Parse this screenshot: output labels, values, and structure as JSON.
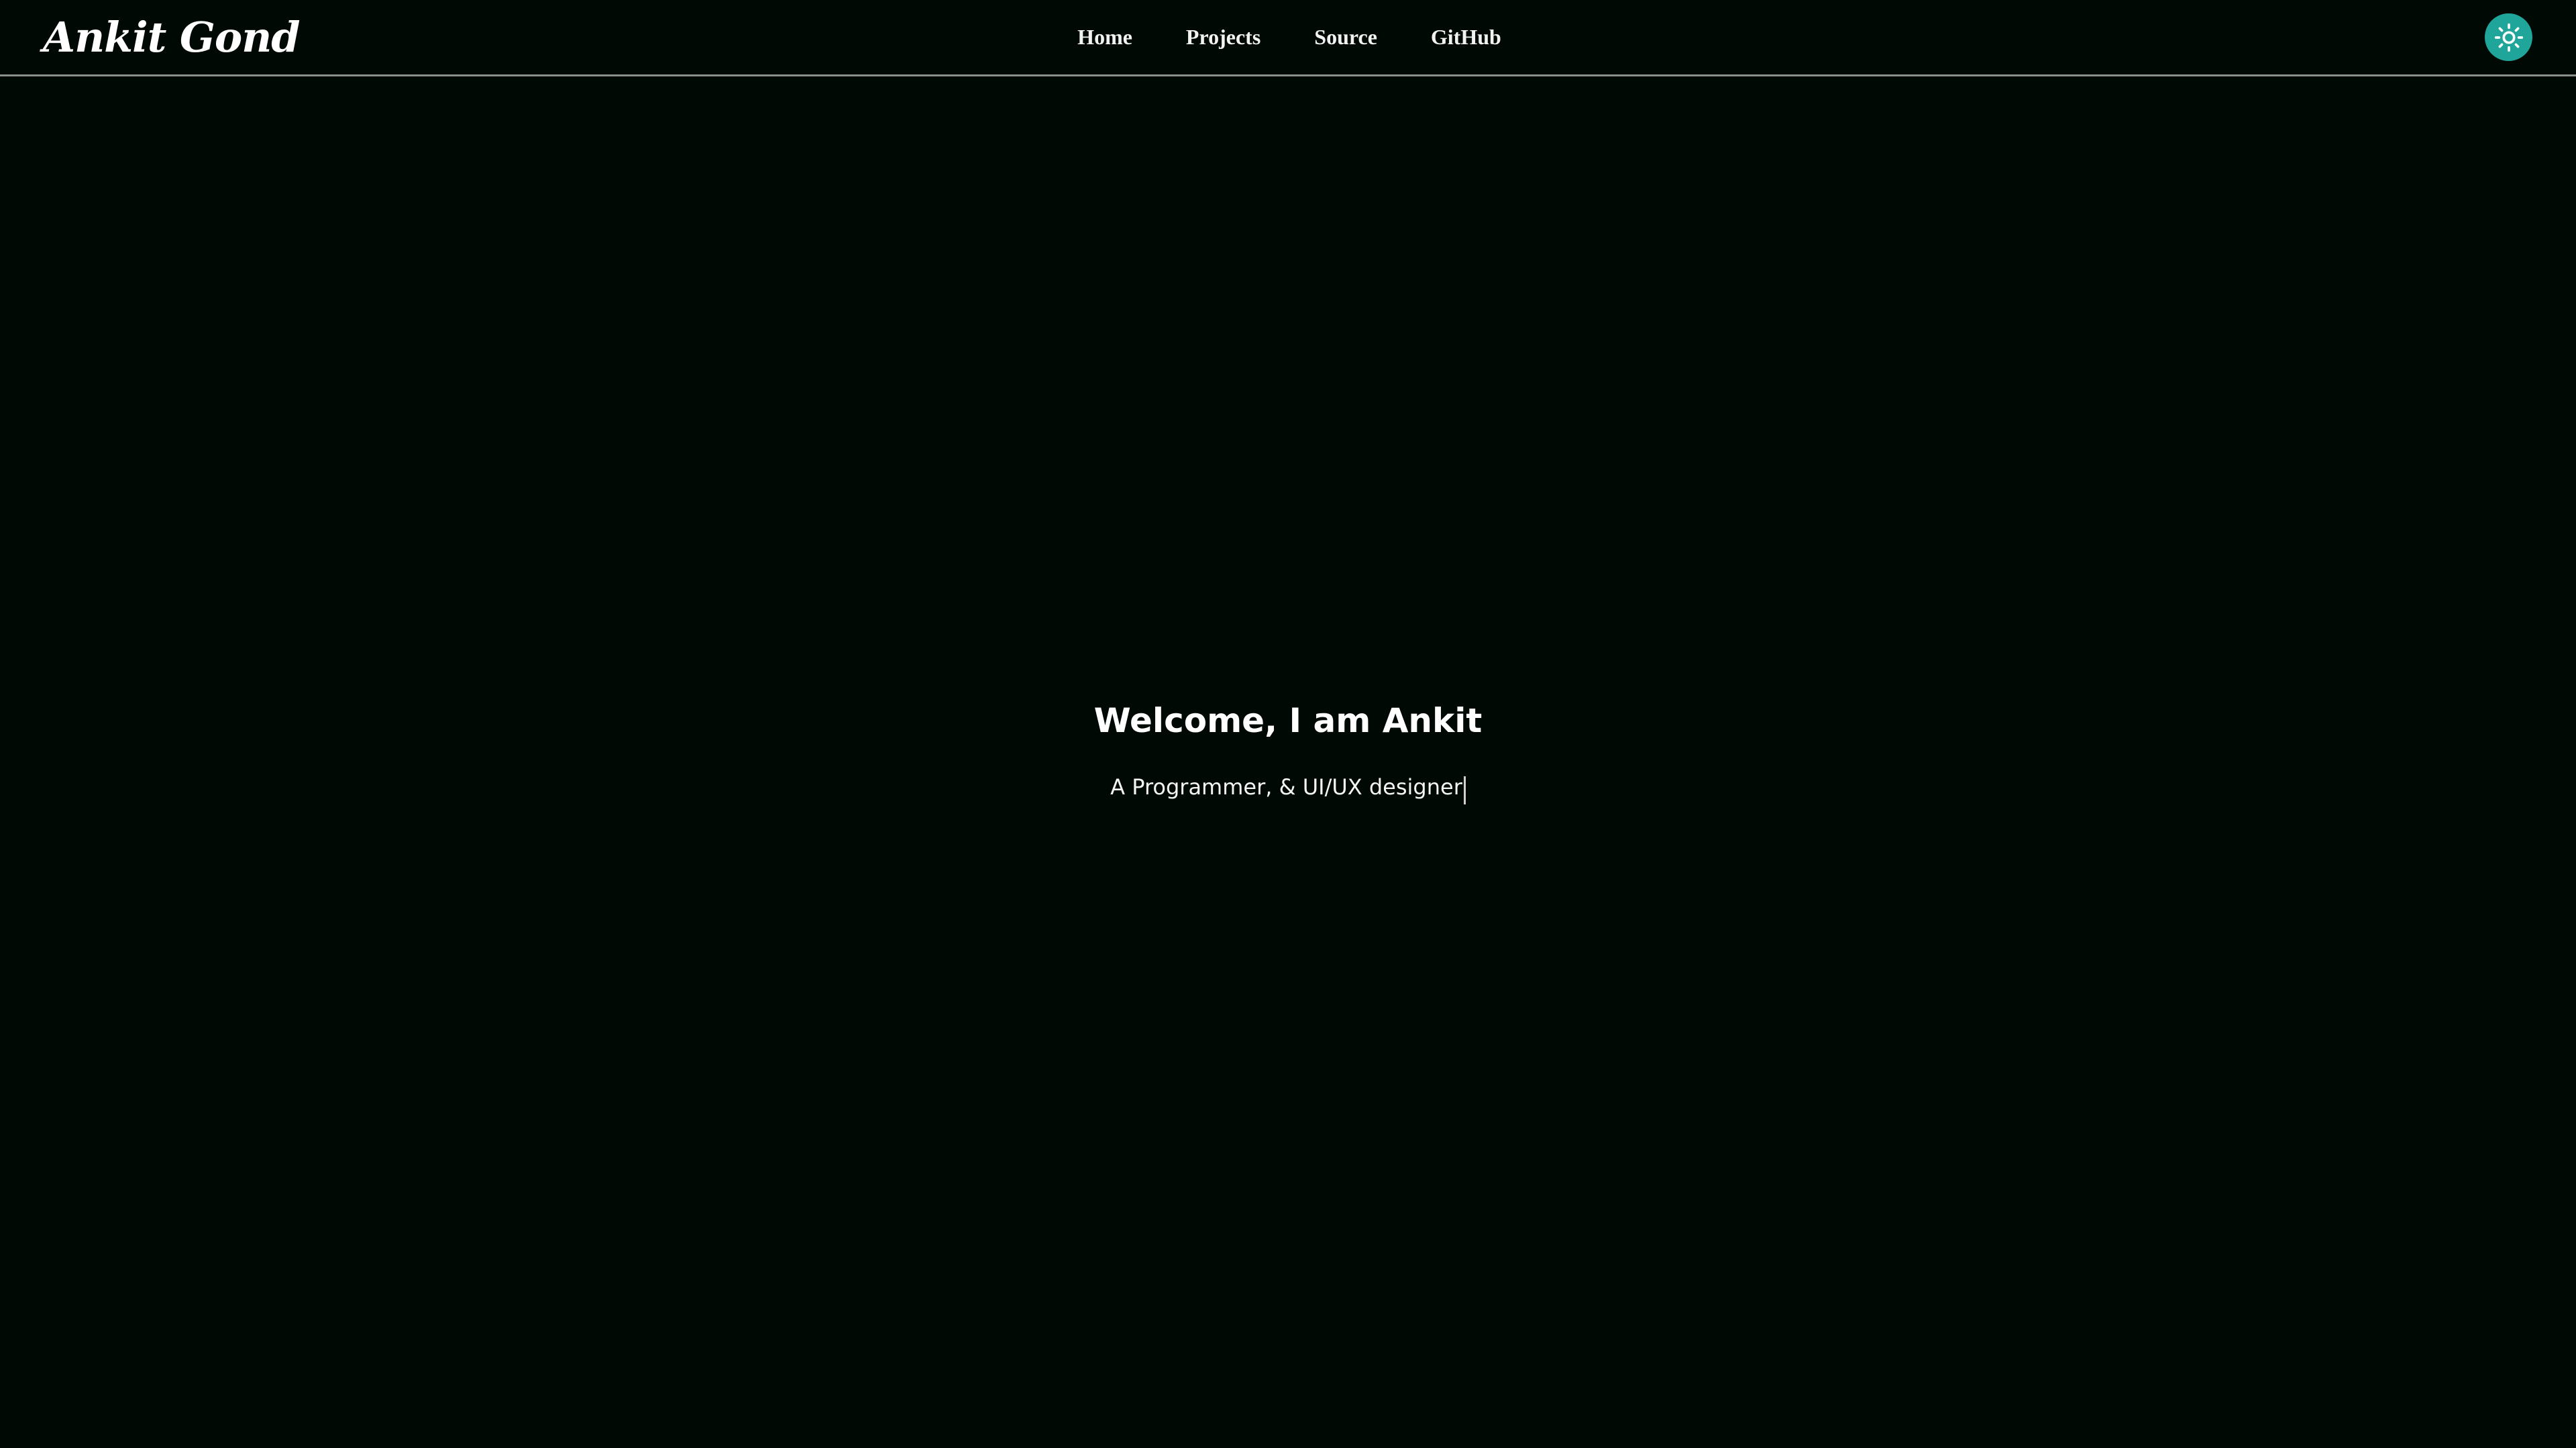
{
  "navbar": {
    "logo": "Ankit Gond",
    "links": [
      "Home",
      "Projects",
      "Source",
      "GitHub"
    ],
    "theme_toggle_icon": "sun-icon",
    "accent_color": "#1fa59a"
  },
  "hero": {
    "title": "Welcome, I am Ankit",
    "subtitle": "A Programmer, & UI/UX designer"
  },
  "colors": {
    "background": "#000904",
    "text": "#ffffff",
    "divider": "#8a8f8c"
  }
}
